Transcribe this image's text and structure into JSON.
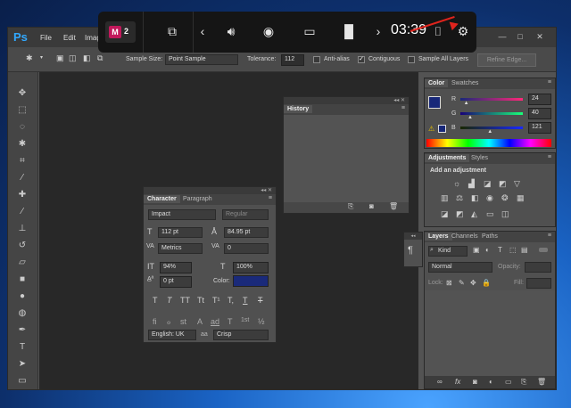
{
  "app": {
    "logo": "Ps",
    "menu": [
      "File",
      "Edit",
      "Imag"
    ],
    "window_controls": {
      "minimize": "—",
      "maximize": "□",
      "close": "✕"
    }
  },
  "options_bar": {
    "sample_size_label": "Sample Size:",
    "sample_size_value": "Point Sample",
    "tolerance_label": "Tolerance:",
    "tolerance_value": "112",
    "anti_alias_label": "Anti-alias",
    "anti_alias_checked": false,
    "contiguous_label": "Contiguous",
    "contiguous_checked": true,
    "sample_all_layers_label": "Sample All Layers",
    "sample_all_layers_checked": false,
    "refine_edge_label": "Refine Edge..."
  },
  "gamebar": {
    "badge_letter": "M",
    "badge_count": "2",
    "time": "03:39",
    "icons": [
      "widget-icon",
      "chevron-left-icon",
      "audio-icon",
      "capture-icon",
      "performance-icon",
      "resources-icon",
      "chevron-right-icon",
      "mouse-icon",
      "settings-icon"
    ],
    "badge_color": "#c2185b"
  },
  "history_panel": {
    "title": "History"
  },
  "character_panel": {
    "tabs": [
      "Character",
      "Paragraph"
    ],
    "font_family": "Impact",
    "font_style": "Regular",
    "font_size": "112 pt",
    "leading": "84.95 pt",
    "kerning": "Metrics",
    "tracking": "0",
    "vertical_scale": "94%",
    "horizontal_scale": "100%",
    "baseline_shift": "0 pt",
    "color_label": "Color:",
    "color_value": "#1a2a7a",
    "type_buttons": [
      "T",
      "T",
      "TT",
      "Tt",
      "T¹",
      "T,",
      "T",
      "T"
    ],
    "opentype_buttons": [
      "fi",
      "ℴ",
      "st",
      "A",
      "ad",
      "T",
      "1st",
      "½"
    ],
    "language": "English: UK",
    "aa_label": "aa",
    "antialias": "Crisp"
  },
  "color_panel": {
    "tabs": [
      "Color",
      "Swatches"
    ],
    "r_label": "R",
    "g_label": "G",
    "b_label": "B",
    "r_value": "24",
    "g_value": "40",
    "b_value": "121",
    "r_fraction": 0.094,
    "g_fraction": 0.157,
    "b_fraction": 0.475,
    "foreground_color": "#182879"
  },
  "adjustments_panel": {
    "tabs": [
      "Adjustments",
      "Styles"
    ],
    "heading": "Add an adjustment"
  },
  "layers_panel": {
    "tabs": [
      "Layers",
      "Channels",
      "Paths"
    ],
    "filter_kind": "Kind",
    "blend_mode": "Normal",
    "opacity_label": "Opacity:",
    "lock_label": "Lock:",
    "fill_label": "Fill:"
  }
}
